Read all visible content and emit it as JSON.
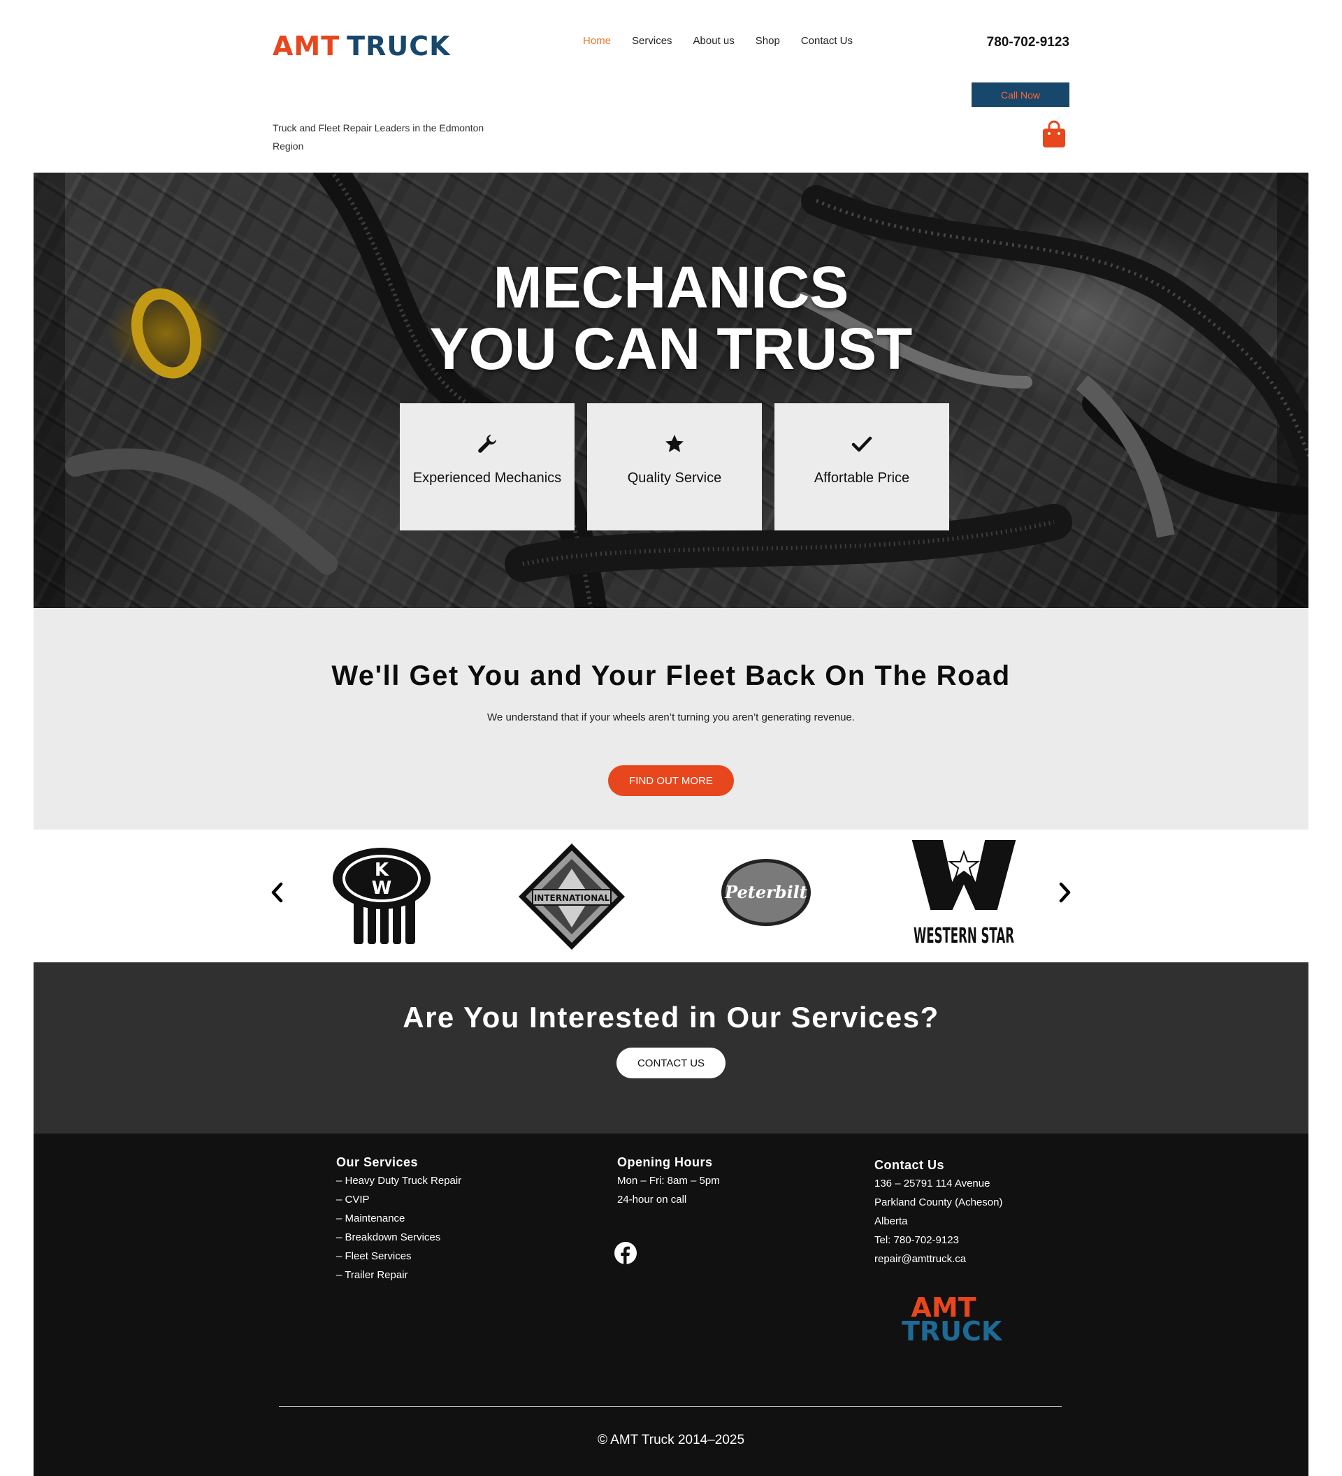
{
  "header": {
    "logo_part1": "AMT",
    "logo_part2": "TRUCK",
    "tagline": "Truck and Fleet Repair Leaders in the Edmonton Region",
    "nav": [
      "Home",
      "Services",
      "About us",
      "Shop",
      "Contact Us"
    ],
    "active_nav": "Home",
    "phone": "780-702-9123",
    "call_button": "Call Now",
    "cart_icon": "shopping-bag-icon"
  },
  "hero": {
    "title_line1": "MECHANICS",
    "title_line2": "YOU CAN TRUST",
    "features": [
      {
        "icon": "wrench-icon",
        "label": "Experienced Mechanics"
      },
      {
        "icon": "star-icon",
        "label": "Quality Service"
      },
      {
        "icon": "checkmark-icon",
        "label": "Affortable Price"
      }
    ]
  },
  "fleet": {
    "title": "We'll Get You and Your Fleet Back On The Road",
    "subtitle": "We understand that if your wheels aren’t turning you aren’t generating revenue.",
    "button": "FIND OUT MORE"
  },
  "brands": {
    "prev_icon": "chevron-left-icon",
    "next_icon": "chevron-right-icon",
    "logos": [
      {
        "name": "kenworth-logo",
        "text": "KW"
      },
      {
        "name": "international-logo",
        "text": "INTERNATIONAL"
      },
      {
        "name": "peterbilt-logo",
        "text": "Peterbilt"
      },
      {
        "name": "western-star-logo",
        "text": "WESTERN STAR"
      }
    ]
  },
  "cta": {
    "title": "Are You Interested in Our Services?",
    "button": "CONTACT US"
  },
  "footer": {
    "services_title": "Our Services",
    "services": [
      "– Heavy Duty Truck Repair",
      "– CVIP",
      "– Maintenance",
      "– Breakdown Services",
      "– Fleet Services",
      "– Trailer Repair"
    ],
    "hours_title": "Opening Hours",
    "hours": [
      "Mon – Fri: 8am – 5pm",
      "24-hour on call"
    ],
    "contact_title": "Contact Us",
    "contact": [
      "136 – 25791 114 Avenue",
      "Parkland County (Acheson)",
      "Alberta",
      "Tel: 780-702-9123",
      "repair@amttruck.ca"
    ],
    "social_icon": "facebook-icon",
    "logo_part1": "AMT",
    "logo_part2": "TRUCK",
    "copyright": "© AMT Truck 2014–2025"
  },
  "colors": {
    "accent_orange": "#e8461c",
    "brand_blue": "#17476a",
    "nav_active": "#f07a2c",
    "section_grey": "#ebebeb",
    "cta_dark": "#303030",
    "footer_dark": "#111111"
  }
}
